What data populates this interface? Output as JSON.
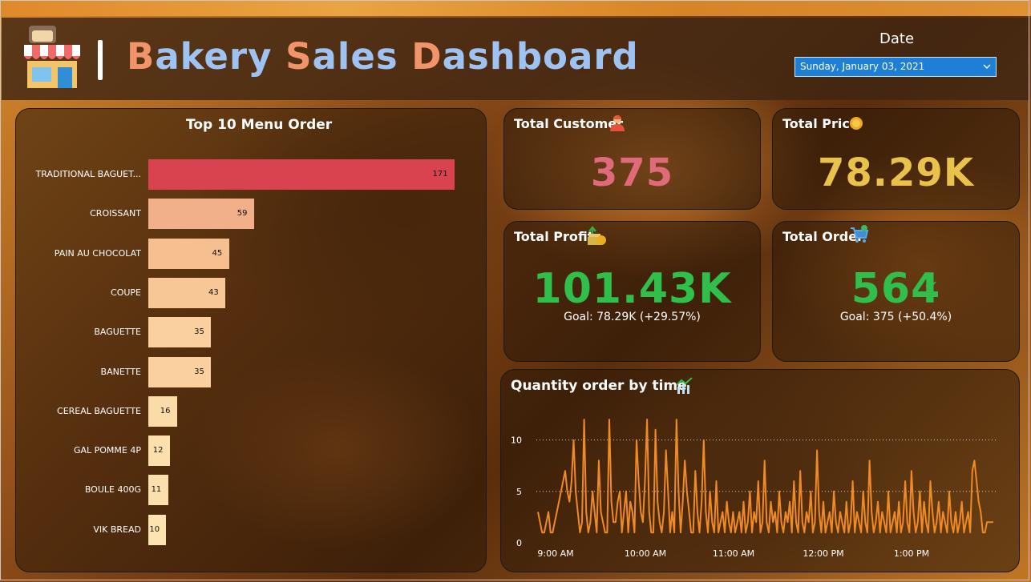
{
  "header": {
    "title_parts": [
      {
        "cap": "B",
        "rest": "akery "
      },
      {
        "cap": "S",
        "rest": "ales "
      },
      {
        "cap": "D",
        "rest": "ashboard"
      }
    ],
    "date_label": "Date",
    "date_value": "Sunday, January 03, 2021"
  },
  "top_menu": {
    "title": "Top 10 Menu Order",
    "colors": [
      "#d9434f",
      "#f2b08a",
      "#f6bf8f",
      "#f7c795",
      "#f9d09e",
      "#f9d09e",
      "#fbdca8",
      "#fbe0ad",
      "#fbe0ad",
      "#fce3b0"
    ]
  },
  "kpis": {
    "customer": {
      "label": "Total Customer",
      "value": "375",
      "color": "#e06a7a",
      "icon": "customer-icon"
    },
    "price": {
      "label": "Total Price",
      "value": "78.29K",
      "color": "#e8c24a",
      "icon": "coin-icon"
    },
    "profit": {
      "label": "Total Profit",
      "value": "101.43K",
      "goal": "Goal: 78.29K (+29.57%)",
      "color": "#2fbf4a",
      "icon": "money-up-icon"
    },
    "order": {
      "label": "Total Order",
      "value": "564",
      "goal": "Goal: 375 (+50.4%)",
      "color": "#2fbf4a",
      "icon": "cart-icon"
    }
  },
  "line_chart_title": "Quantity order by time",
  "chart_data": [
    {
      "type": "bar",
      "orientation": "horizontal",
      "title": "Top 10 Menu Order",
      "categories": [
        "TRADITIONAL BAGUET...",
        "CROISSANT",
        "PAIN AU CHOCOLAT",
        "COUPE",
        "BAGUETTE",
        "BANETTE",
        "CEREAL BAGUETTE",
        "GAL POMME 4P",
        "BOULE 400G",
        "VIK BREAD"
      ],
      "values": [
        171,
        59,
        45,
        43,
        35,
        35,
        16,
        12,
        11,
        10
      ]
    },
    {
      "type": "line",
      "title": "Quantity order by time",
      "x_ticks": [
        "9:00 AM",
        "10:00 AM",
        "11:00 AM",
        "12:00 PM",
        "1:00 PM"
      ],
      "y_ticks": [
        0,
        5,
        10
      ],
      "ylim": [
        0,
        12
      ],
      "xlim": [
        "8:40 AM",
        "1:50 PM"
      ],
      "grid": "horizontal dotted",
      "color": "#f08a24",
      "values": [
        3,
        2,
        1,
        1,
        2,
        3,
        1,
        1,
        2,
        3,
        4,
        5,
        6,
        7,
        5,
        4,
        6,
        10,
        5,
        3,
        1,
        2,
        12,
        3,
        1,
        2,
        5,
        3,
        1,
        8,
        3,
        2,
        1,
        1,
        12,
        4,
        2,
        2,
        4,
        5,
        1,
        3,
        5,
        1,
        4,
        3,
        1,
        10,
        6,
        3,
        2,
        6,
        12,
        3,
        1,
        1,
        11,
        4,
        2,
        1,
        3,
        9,
        5,
        1,
        3,
        1,
        12,
        5,
        1,
        4,
        8,
        5,
        3,
        1,
        1,
        7,
        3,
        1,
        4,
        10,
        3,
        1,
        5,
        2,
        1,
        6,
        1,
        2,
        3,
        1,
        4,
        2,
        1,
        3,
        1,
        2,
        3,
        1,
        4,
        1,
        2,
        5,
        1,
        3,
        2,
        6,
        1,
        2,
        8,
        2,
        1,
        4,
        2,
        3,
        1,
        5,
        2,
        1,
        3,
        2,
        4,
        1,
        6,
        2,
        1,
        7,
        2,
        1,
        3,
        2,
        5,
        1,
        2,
        9,
        3,
        1,
        4,
        1,
        2,
        3,
        1,
        5,
        2,
        1,
        3,
        2,
        1,
        4,
        1,
        2,
        6,
        1,
        3,
        2,
        1,
        5,
        2,
        1,
        8,
        3,
        1,
        2,
        4,
        1,
        3,
        2,
        1,
        5,
        1,
        2,
        3,
        1,
        4,
        1,
        2,
        6,
        2,
        1,
        7,
        3,
        1,
        2,
        5,
        1,
        4,
        2,
        1,
        6,
        3,
        1,
        2,
        4,
        1,
        3,
        2,
        1,
        5,
        2,
        1,
        3,
        1,
        2,
        4,
        1,
        2,
        3,
        1,
        7,
        8,
        6,
        4,
        3,
        1,
        1,
        2,
        2,
        2,
        2
      ]
    }
  ]
}
